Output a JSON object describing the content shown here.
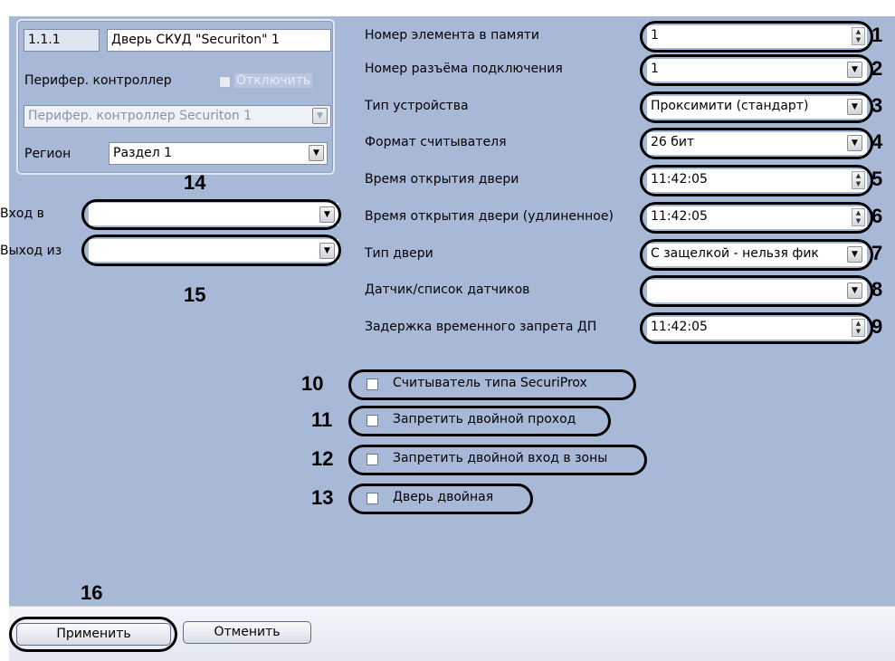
{
  "form": {
    "id_value": "1.1.1",
    "name_value": "Дверь СКУД \"Securiton\" 1",
    "controller_label": "Перифер. контроллер",
    "disable_label": "Отключить",
    "controller_value": "Перифер. контроллер Securiton 1",
    "region_label": "Регион",
    "region_value": "Раздел 1",
    "entry_label": "Вход в",
    "entry_value": "",
    "exit_label": "Выход из",
    "exit_value": ""
  },
  "fields": [
    {
      "label": "Номер элемента в памяти",
      "value": "1",
      "callout": "1"
    },
    {
      "label": "Номер разъёма подключения",
      "value": "1",
      "callout": "2"
    },
    {
      "label": "Тип устройства",
      "value": "Проксимити (стандарт)",
      "callout": "3"
    },
    {
      "label": "Формат считывателя",
      "value": "26 бит",
      "callout": "4"
    },
    {
      "label": "Время открытия двери",
      "value": "11:42:05",
      "callout": "5"
    },
    {
      "label": "Время открытия двери (удлиненное)",
      "value": "11:42:05",
      "callout": "6"
    },
    {
      "label": "Тип двери",
      "value": "С защелкой - нельзя фик",
      "callout": "7"
    },
    {
      "label": "Датчик/список датчиков",
      "value": "",
      "callout": "8"
    },
    {
      "label": "Задержка временного запрета ДП",
      "value": "11:42:05",
      "callout": "9"
    }
  ],
  "checkboxes": [
    {
      "label": "Считыватель типа SecuriProx",
      "checked": false,
      "callout": "10"
    },
    {
      "label": "Запретить двойной проход",
      "checked": false,
      "callout": "11"
    },
    {
      "label": "Запретить двойной вход в зоны",
      "checked": false,
      "callout": "12"
    },
    {
      "label": "Дверь двойная",
      "checked": false,
      "callout": "13"
    }
  ],
  "callouts": {
    "entry": "14",
    "exit": "15",
    "apply": "16"
  },
  "buttons": {
    "apply": "Применить",
    "cancel": "Отменить"
  },
  "colors": {
    "panel": "#a8b9d7",
    "page": "#ffffff"
  },
  "icons": {
    "dropdown": "chevron-down-icon",
    "spinner": "spinner-icon",
    "checkbox": "checkbox-icon"
  }
}
